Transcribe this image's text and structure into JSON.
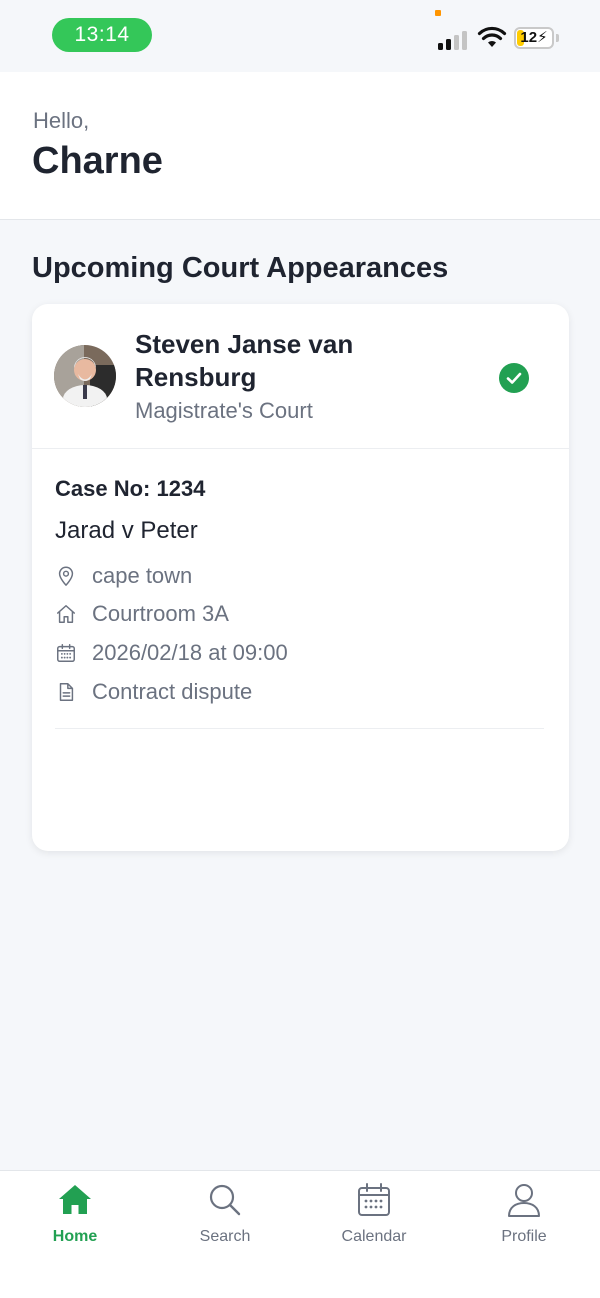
{
  "status_bar": {
    "time": "13:14",
    "battery_level": "12",
    "signal_icon": "cellular-signal-icon",
    "wifi_icon": "wifi-icon",
    "accent_color": "#34c759"
  },
  "header": {
    "greeting": "Hello,",
    "user_name": "Charne"
  },
  "section": {
    "title": "Upcoming Court Appearances"
  },
  "appearance": {
    "lawyer_name": "Steven Janse van Rensburg",
    "court_type": "Magistrate's Court",
    "status_icon": "check-circle-icon",
    "status_color": "#22a052",
    "case_no": "Case No: 1234",
    "case_title": "Jarad v Peter",
    "location": "cape town",
    "courtroom": "Courtroom 3A",
    "datetime": "2026/02/18 at 09:00",
    "case_type": "Contract dispute"
  },
  "nav": {
    "active_color": "#22a052",
    "items": [
      {
        "label": "Home",
        "icon": "home-icon",
        "active": true
      },
      {
        "label": "Search",
        "icon": "search-icon",
        "active": false
      },
      {
        "label": "Calendar",
        "icon": "calendar-icon",
        "active": false
      },
      {
        "label": "Profile",
        "icon": "profile-icon",
        "active": false
      }
    ]
  }
}
